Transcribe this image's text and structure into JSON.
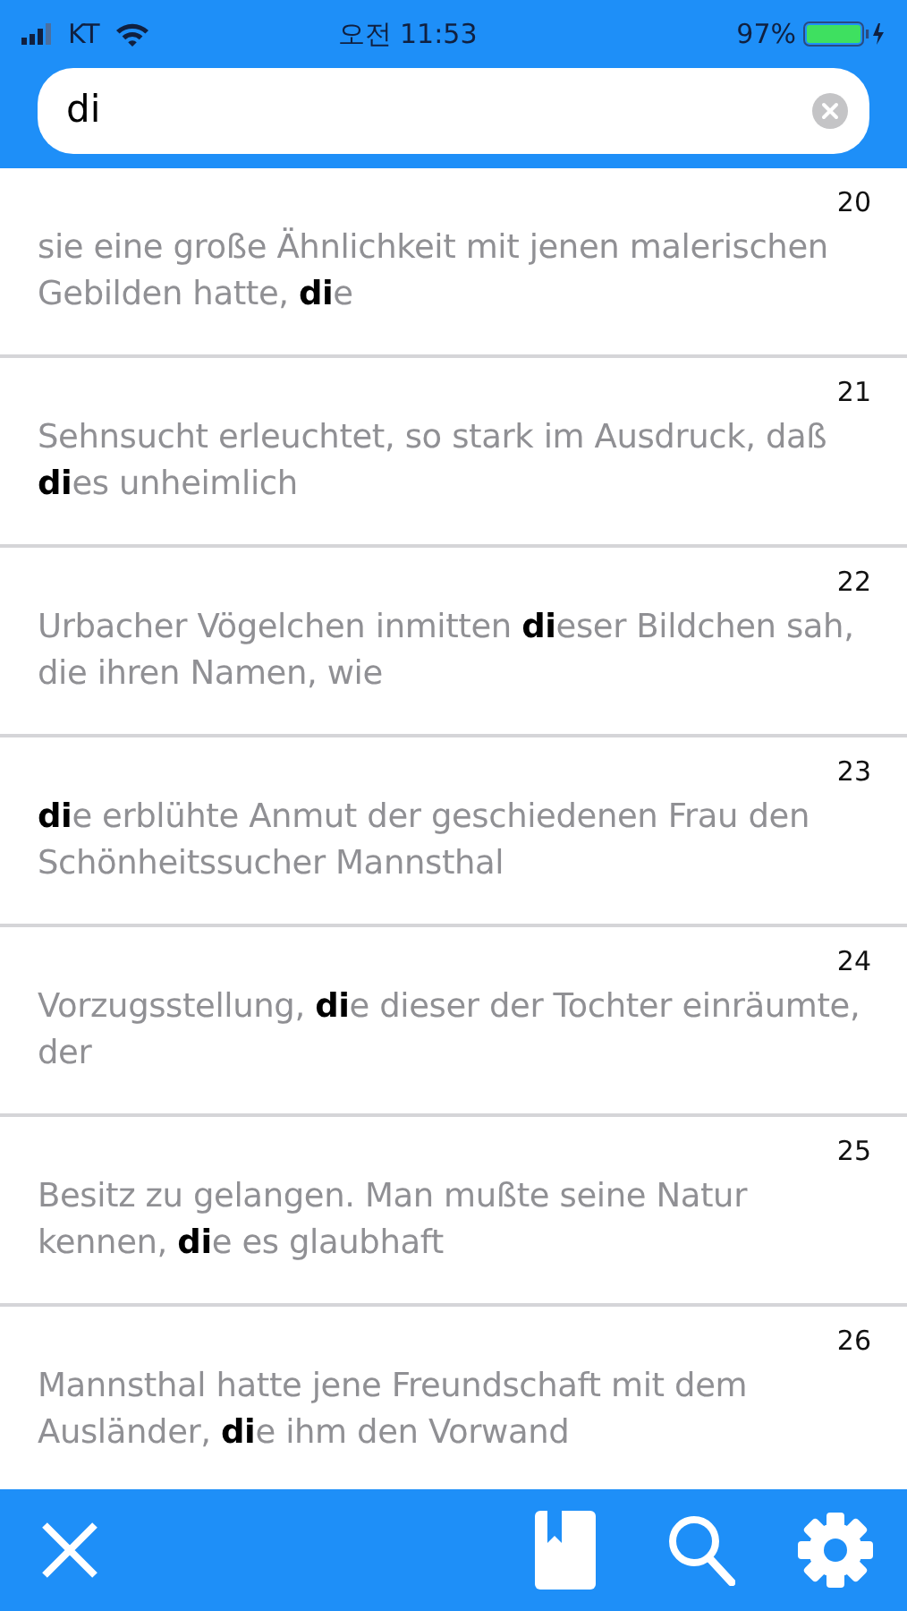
{
  "status_bar": {
    "carrier": "KT",
    "time": "오전 11:53",
    "battery": "97%"
  },
  "search": {
    "value": "di"
  },
  "results": [
    {
      "number": "20",
      "text": "sie eine große Ähnlichkeit mit jenen malerischen Gebilden hatte, **di**e"
    },
    {
      "number": "21",
      "text": "Sehnsucht erleuchtet, so stark im Ausdruck, daß **di**es unheimlich"
    },
    {
      "number": "22",
      "text": "Urbacher Vögelchen inmitten **di**eser Bildchen sah, die ihren Namen, wie"
    },
    {
      "number": "23",
      "text": "**di**e erblühte Anmut der geschiedenen Frau den Schönheitssucher Mannsthal"
    },
    {
      "number": "24",
      "text": "Vorzugsstellung, **di**e dieser der Tochter einräumte, der"
    },
    {
      "number": "25",
      "text": "Besitz zu gelangen. Man mußte seine Natur kennen, **di**e es glaubhaft"
    },
    {
      "number": "26",
      "text": "Mannsthal hatte jene Freundschaft mit dem Ausländer, **di**e ihm den Vorwand"
    }
  ]
}
